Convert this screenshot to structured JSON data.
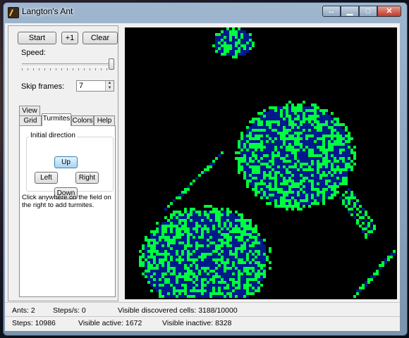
{
  "window": {
    "title": "Langton's Ant",
    "icons": {
      "app": "ant-icon",
      "resize": "resize-icon",
      "minimize": "minimize-icon",
      "maximize": "maximize-icon",
      "close": "close-icon"
    }
  },
  "controls": {
    "start_label": "Start",
    "step_label": "+1",
    "clear_label": "Clear",
    "speed_label": "Speed:",
    "speed_value_fraction": 0.96,
    "skip_frames_label": "Skip frames:",
    "skip_frames_value": "7"
  },
  "tabs": {
    "top_row": [
      "View"
    ],
    "bottom_row": [
      "Grid",
      "Turmites",
      "Colors",
      "Help"
    ],
    "active": "Turmites"
  },
  "turmites": {
    "group_label": "Initial direction",
    "up_label": "Up",
    "left_label": "Left",
    "right_label": "Right",
    "down_label": "Down",
    "selected": "Up",
    "hint": "Click anywhere on the field on the right to add turmites."
  },
  "field": {
    "colors": {
      "background": "#000000",
      "active": "#00ff3c",
      "inactive": "#001a8c"
    }
  },
  "status": {
    "ants": "Ants: 2",
    "steps_per_second": "Steps/s: 0",
    "visible_discovered": "Visible discovered cells: 3188/10000",
    "steps": "Steps: 10986",
    "visible_active": "Visible active: 1672",
    "visible_inactive": "Visible inactive: 8328"
  }
}
